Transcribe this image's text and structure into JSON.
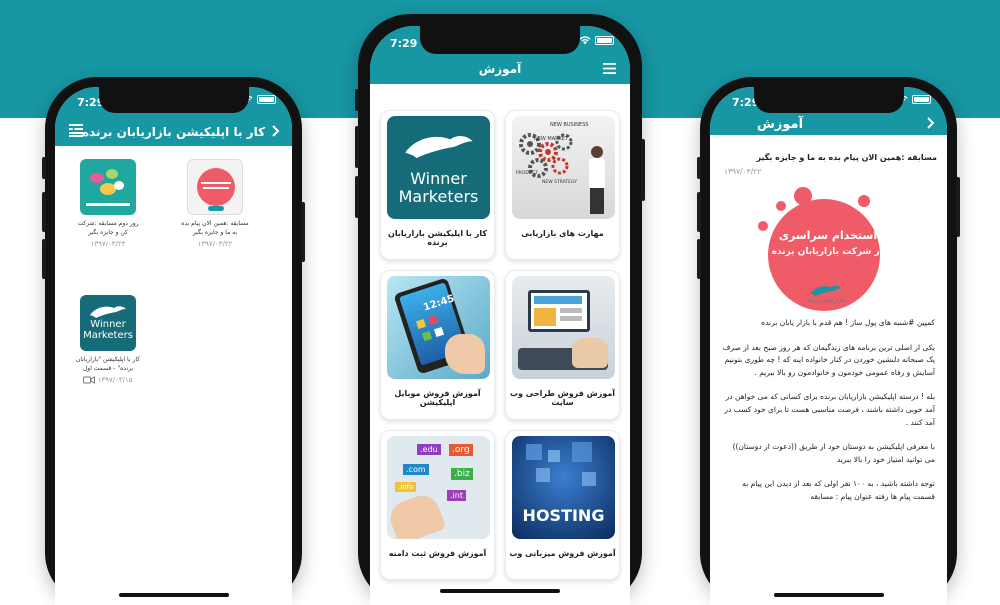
{
  "status": {
    "time": "7:29"
  },
  "phone1": {
    "title": "کار با اپلیکیشن بازاریابان برنده",
    "items": [
      {
        "caption": "مسابقه :همین الان پیام بده به ما و جایزه بگیر",
        "date": "۱۳۹۷/۰۳/۲۲"
      },
      {
        "caption": "روز دوم مسابقه :شرکت کن و جایزه بگیر",
        "date": "۱۳۹۷/۰۳/۲۳"
      },
      {
        "caption": "کار با اپلیکیشن \"بازاریابان برنده\" - قسمت اول",
        "date": "۱۳۹۷/۰۳/۱۵"
      }
    ],
    "logo_line1": "Winner",
    "logo_line2": "Marketers"
  },
  "phone2": {
    "title": "آموزش",
    "cards": [
      {
        "label": "مهارت های بازاریابی",
        "thumb_text": [
          "NEW BUSINESS",
          "NEW MARKET",
          "PRODUCT",
          "NEW STRATEGY"
        ]
      },
      {
        "label": "کار با اپلیکیشن بازاریابان برنده",
        "thumb_text": [
          "Winner",
          "Marketers"
        ]
      },
      {
        "label": "آموزش فروش طراحی وب سایت"
      },
      {
        "label": "آموزش فروش موبایل اپلیکیشن"
      },
      {
        "label": "آموزش فروش میزبانی وب",
        "thumb_text": [
          "HOSTING"
        ]
      },
      {
        "label": "آموزش فروش ثبت دامنه",
        "thumb_text": [
          ".edu",
          ".org",
          ".com",
          ".biz",
          ".info",
          ".int"
        ]
      }
    ]
  },
  "phone3": {
    "title": "آموزش",
    "message_title": "مسابقه :همین الان پیام بده به ما و جایزه بگیر",
    "message_date": "۱۳۹۷/۰۳/۲۲",
    "promo_line1": "استخدام سراسری",
    "promo_line2": "در شرکت بازاریابان برنده",
    "promo_brand": "بازاریابان برنده",
    "paragraphs": [
      "کمپین #شنبه های پول ساز ! هم قدم با بازار یابان برنده",
      "یکی از اصلی ترین برنامه های زندگیمان که هر روز صبح بعد از صرف یک صبحانه دلنشین خوردن در کنار خانواده اینه که ! چه طوری بتونیم آسایش و رفاه عمومی خودمون و خانوادمون رو بالا ببریم .",
      "بله ! درسته اپلیکیشن بازاریابان برنده برای کسانی که می خواهن در آمد خوبی داشته باشند ، فرصت مناسبی هست تا برای خود کسب در آمد کنند .",
      "با معرفی اپلیکیشن به دوستان خود از طریق ((دعوت از دوستان)) می توانید امتیاز خود را بالا ببرید",
      "توجه داشته باشید ، به ۱۰۰ نفر اولی که بعد از دیدن این پیام به قسمت پیام ها رفته عنوان پیام : مسابقه"
    ]
  },
  "colors": {
    "brand": "#1796a3",
    "promo_red": "#ef5b66"
  }
}
